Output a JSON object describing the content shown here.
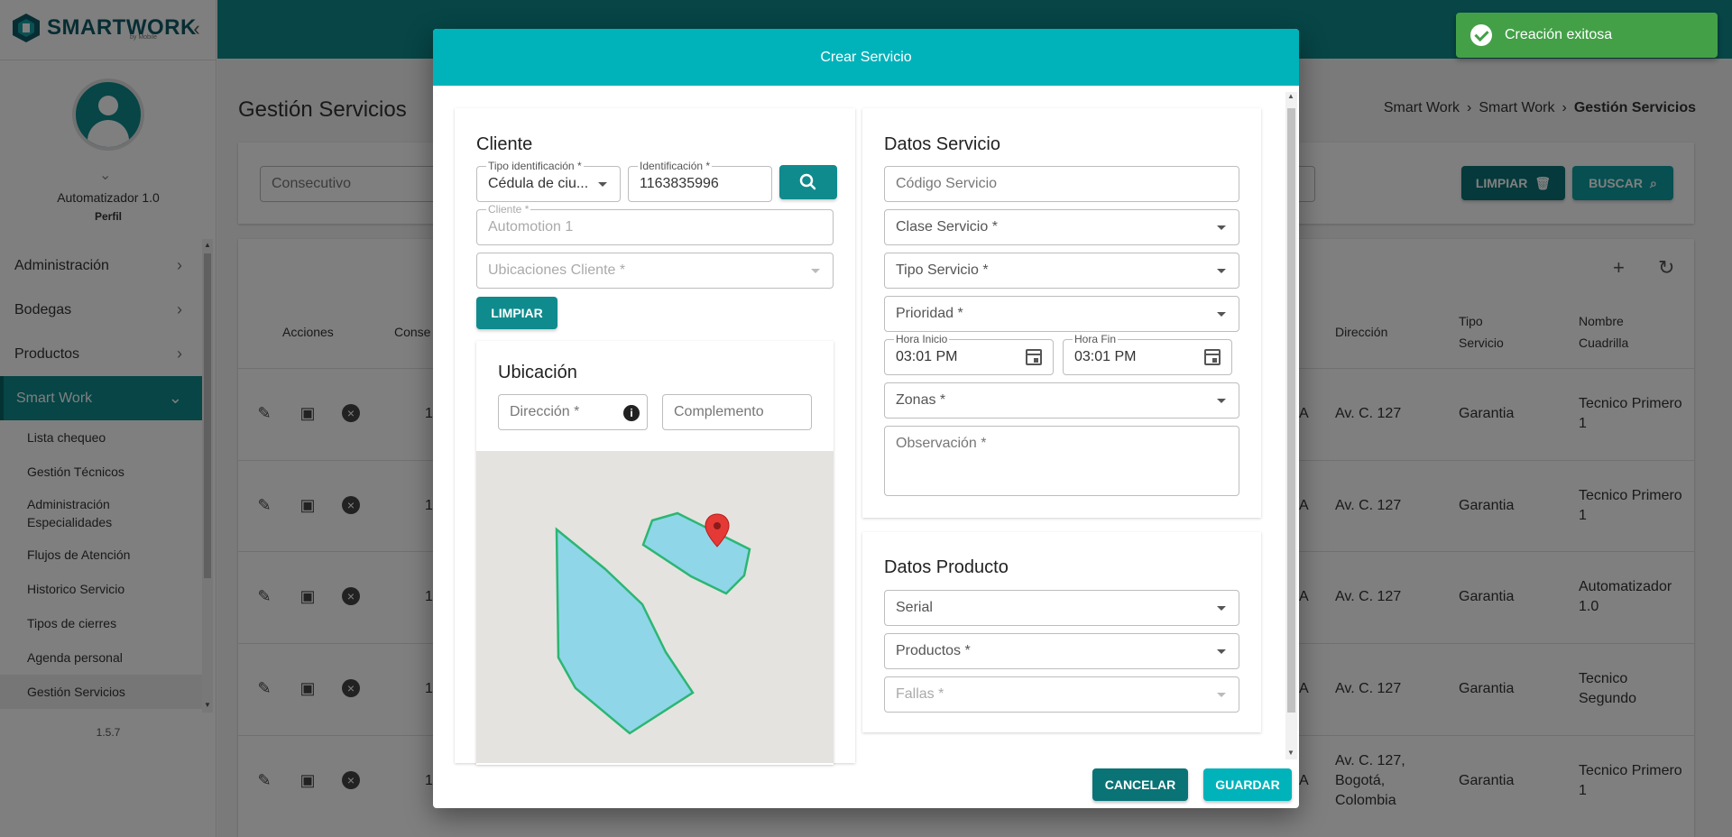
{
  "app": {
    "logo_text": "SMARTWORK",
    "logo_sub": "by Mobile",
    "version": "1.5.7"
  },
  "colors": {
    "primary": "#0f8b8d",
    "accent": "#00b3bb",
    "dark": "#0a7376",
    "success": "#43a047"
  },
  "user": {
    "name": "Automatizador 1.0",
    "role": "Perfil"
  },
  "sidebar": {
    "items": [
      {
        "label": "Administración"
      },
      {
        "label": "Bodegas"
      },
      {
        "label": "Productos"
      },
      {
        "label": "Smart Work"
      }
    ],
    "sub_items": [
      {
        "label": "Lista chequeo"
      },
      {
        "label": "Gestión Técnicos"
      },
      {
        "label": "Administración Especialidades"
      },
      {
        "label": "Flujos de Atención"
      },
      {
        "label": "Historico Servicio"
      },
      {
        "label": "Tipos de cierres"
      },
      {
        "label": "Agenda personal"
      },
      {
        "label": "Gestión Servicios"
      }
    ]
  },
  "page": {
    "title": "Gestión Servicios",
    "breadcrumb": [
      "Smart Work",
      "Smart Work",
      "Gestión Servicios"
    ],
    "filter_placeholder": "Consecutivo",
    "btn_limpiar": "LIMPIAR",
    "btn_buscar": "BUSCAR"
  },
  "table": {
    "headers": {
      "acciones": "Acciones",
      "consecutivo": "Conse",
      "direccion": "Dirección",
      "tipo_servicio": "Tipo Servicio",
      "nombre_cuadrilla": "Nombre Cuadrilla"
    },
    "rows": [
      {
        "consecutivo": "1",
        "estado": "A",
        "direccion": "Av. C. 127",
        "tipo": "Garantia",
        "cuadrilla": "Tecnico Primero 1"
      },
      {
        "consecutivo": "1",
        "estado": "A",
        "direccion": "Av. C. 127",
        "tipo": "Garantia",
        "cuadrilla": "Tecnico Primero 1"
      },
      {
        "consecutivo": "1",
        "estado": "A",
        "direccion": "Av. C. 127",
        "tipo": "Garantia",
        "cuadrilla": "Automatizador 1.0"
      },
      {
        "consecutivo": "1",
        "estado": "A",
        "direccion": "Av. C. 127",
        "tipo": "Garantia",
        "cuadrilla": "Tecnico Segundo"
      },
      {
        "consecutivo": "1",
        "estado": "A",
        "direccion": "Av. C. 127, Bogotá, Colombia",
        "tipo": "Garantia",
        "cuadrilla": "Tecnico Primero 1"
      }
    ]
  },
  "modal": {
    "title": "Crear Servicio",
    "cliente": {
      "title": "Cliente",
      "tipo_id_label": "Tipo identificación *",
      "tipo_id_value": "Cédula de ciu...",
      "id_label": "Identificación *",
      "id_value": "1163835996",
      "cliente_label": "Cliente *",
      "cliente_value": "Automotion 1",
      "ubicaciones_placeholder": "Ubicaciones Cliente *",
      "limpiar": "LIMPIAR"
    },
    "ubicacion": {
      "title": "Ubicación",
      "direccion_placeholder": "Dirección *",
      "complemento_placeholder": "Complemento"
    },
    "datos_servicio": {
      "title": "Datos Servicio",
      "codigo_placeholder": "Código Servicio",
      "clase_placeholder": "Clase Servicio *",
      "tipo_placeholder": "Tipo Servicio *",
      "prioridad_placeholder": "Prioridad *",
      "hora_inicio_label": "Hora Inicio",
      "hora_inicio_value": "03:01 PM",
      "hora_fin_label": "Hora Fin",
      "hora_fin_value": "03:01 PM",
      "zonas_placeholder": "Zonas *",
      "observacion_placeholder": "Observación *"
    },
    "datos_producto": {
      "title": "Datos Producto",
      "serial_placeholder": "Serial",
      "productos_placeholder": "Productos *",
      "fallas_placeholder": "Fallas *"
    },
    "cancelar": "CANCELAR",
    "guardar": "GUARDAR"
  },
  "toast": {
    "message": "Creación exitosa"
  }
}
